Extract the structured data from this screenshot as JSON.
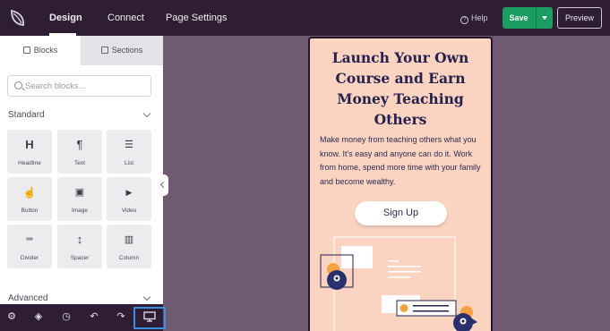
{
  "topbar": {
    "tabs": [
      {
        "label": "Design",
        "active": true
      },
      {
        "label": "Connect",
        "active": false
      },
      {
        "label": "Page Settings",
        "active": false
      }
    ],
    "help_label": "Help",
    "save_label": "Save",
    "preview_label": "Preview"
  },
  "sidebar": {
    "tabs": [
      {
        "label": "Blocks",
        "active": true
      },
      {
        "label": "Sections",
        "active": false
      }
    ],
    "search_placeholder": "Search blocks...",
    "standard_label": "Standard",
    "advanced_label": "Advanced",
    "blocks": [
      {
        "label": "Headline",
        "icon": "heading-icon",
        "glyph": "H"
      },
      {
        "label": "Text",
        "icon": "paragraph-icon",
        "glyph": "¶"
      },
      {
        "label": "List",
        "icon": "list-icon",
        "glyph": "☰"
      },
      {
        "label": "Button",
        "icon": "pointer-icon",
        "glyph": "☝"
      },
      {
        "label": "Image",
        "icon": "image-icon",
        "glyph": "▣"
      },
      {
        "label": "Video",
        "icon": "video-icon",
        "glyph": "▶"
      },
      {
        "label": "Divider",
        "icon": "divider-icon",
        "glyph": "═"
      },
      {
        "label": "Spacer",
        "icon": "spacer-icon",
        "glyph": "↕"
      },
      {
        "label": "Column",
        "icon": "column-icon",
        "glyph": "▥"
      }
    ]
  },
  "bottom_toolbar": {
    "icons": [
      "settings-icon",
      "layers-icon",
      "history-icon",
      "undo-icon",
      "redo-icon",
      "desktop-preview-icon"
    ],
    "active": "desktop-preview-icon"
  },
  "canvas": {
    "headline": "Launch Your Own Course and Earn Money Teaching Others",
    "body": "Make money from teaching others what you know. It's easy and anyone can do it. Work from home, spend more time with your family and become wealthy.",
    "button_label": "Sign Up"
  },
  "colors": {
    "topbar_bg": "#2f1d34",
    "canvas_bg": "#6f5a72",
    "save_green": "#1a9d61",
    "page_bg": "#fbd4c1",
    "headline": "#26214d",
    "highlight_blue": "#3b8fe3",
    "illustration_orange": "#f4a340"
  }
}
